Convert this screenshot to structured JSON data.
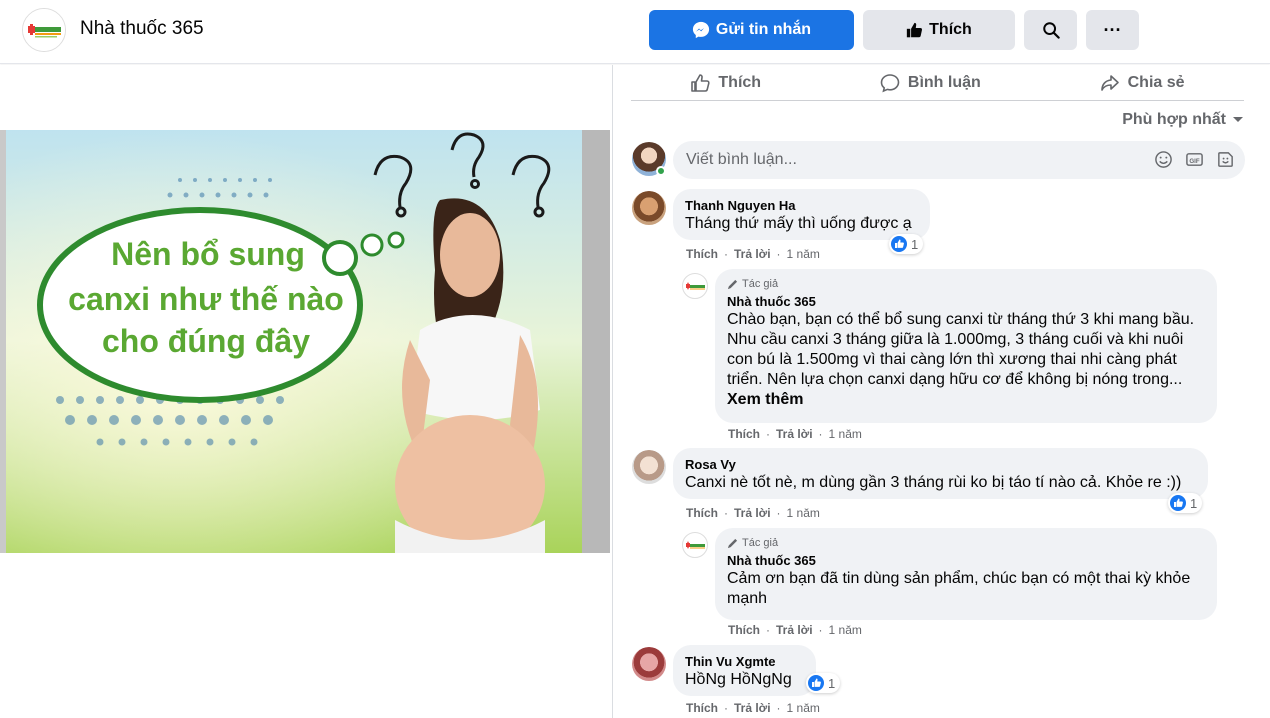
{
  "header": {
    "page_name": "Nhà thuốc 365",
    "send_message_label": "Gửi tin nhắn",
    "like_label": "Thích",
    "more_label": "···"
  },
  "actions": {
    "like": "Thích",
    "comment": "Bình luận",
    "share": "Chia sẻ"
  },
  "sort_label": "Phù hợp nhất",
  "composer": {
    "placeholder": "Viết bình luận..."
  },
  "post_image": {
    "headline_line1": "Nên bổ sung",
    "headline_line2": "canxi như thế nào",
    "headline_line3": "cho đúng đây"
  },
  "comments": [
    {
      "author": "Thanh Nguyen Ha",
      "text": "Tháng thứ mấy thì uống được ạ",
      "like_action": "Thích",
      "reply_action": "Trả lời",
      "time": "1 năm",
      "reactions": "1",
      "reply": {
        "tag": "Tác giả",
        "author": "Nhà thuốc 365",
        "text": "Chào bạn, bạn có thể bổ sung canxi từ tháng thứ 3 khi mang bầu. Nhu cầu canxi 3 tháng giữa là 1.000mg, 3 tháng cuối và khi nuôi con bú là 1.500mg vì thai càng lớn thì xương thai nhi càng phát triển. Nên lựa chọn canxi dạng hữu cơ để không bị nóng trong...",
        "see_more": "Xem thêm",
        "like_action": "Thích",
        "reply_action": "Trả lời",
        "time": "1 năm"
      }
    },
    {
      "author": "Rosa Vy",
      "text": "Canxi nè tốt nè, m dùng gần 3 tháng rùi ko bị táo tí nào cả. Khỏe re :))",
      "like_action": "Thích",
      "reply_action": "Trả lời",
      "time": "1 năm",
      "reactions": "1",
      "reply": {
        "tag": "Tác giả",
        "author": "Nhà thuốc 365",
        "text": "Cảm ơn bạn đã tin dùng sản phẩm, chúc bạn có một thai kỳ khỏe mạnh",
        "like_action": "Thích",
        "reply_action": "Trả lời",
        "time": "1 năm"
      }
    },
    {
      "author": "Thin Vu Xgmte",
      "text": "HồNg HồNgNg",
      "like_action": "Thích",
      "reply_action": "Trả lời",
      "time": "1 năm",
      "reactions": "1"
    }
  ],
  "colors": {
    "primary_blue": "#1b74e4",
    "secondary_gray": "#e4e6eb",
    "bubble_gray": "#f0f2f5",
    "muted_text": "#65676b",
    "brand_green": "#3f9a3a"
  }
}
